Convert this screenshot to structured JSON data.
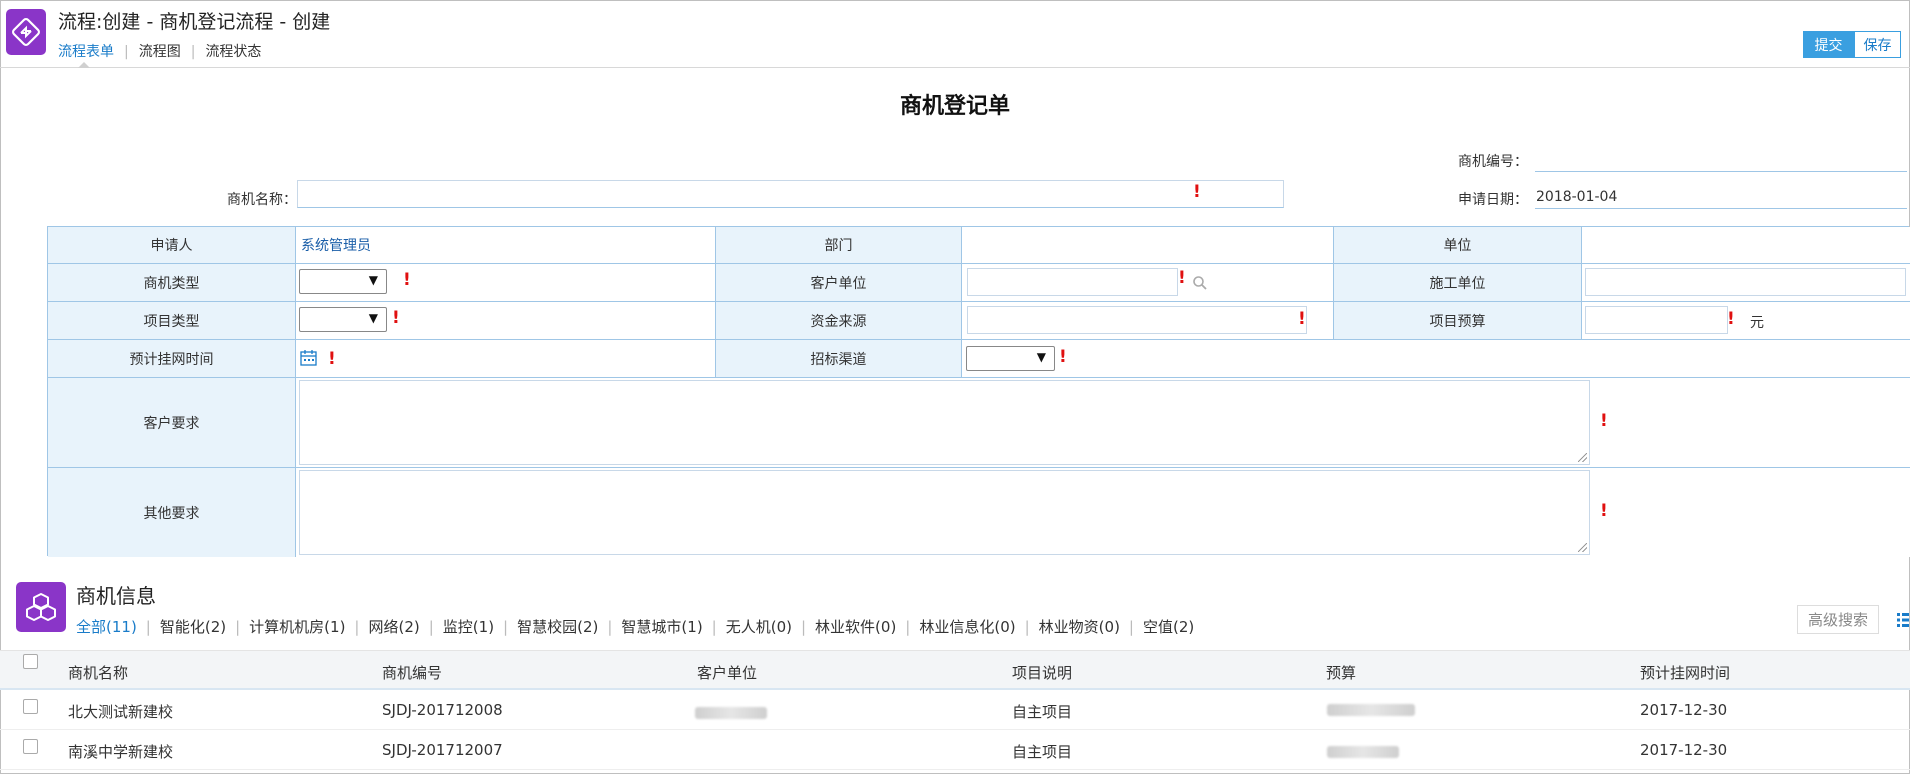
{
  "header": {
    "title": "流程:创建 - 商机登记流程 - 创建",
    "tabs": [
      {
        "label": "流程表单",
        "active": true
      },
      {
        "label": "流程图",
        "active": false
      },
      {
        "label": "流程状态",
        "active": false
      }
    ],
    "submit_label": "提交",
    "save_label": "保存"
  },
  "form": {
    "title": "商机登记单",
    "number_label": "商机编号：",
    "number_value": "",
    "name_label": "商机名称：",
    "name_value": "",
    "date_label": "申请日期：",
    "date_value": "2018-01-04",
    "grid": {
      "applicant_label": "申请人",
      "applicant_value": "系统管理员",
      "dept_label": "部门",
      "dept_value": "",
      "unit_label": "单位",
      "unit_value": "",
      "opp_type_label": "商机类型",
      "customer_unit_label": "客户单位",
      "construction_unit_label": "施工单位",
      "project_type_label": "项目类型",
      "fund_source_label": "资金来源",
      "project_budget_label": "项目预算",
      "budget_unit": "元",
      "online_time_label": "预计挂网时间",
      "bid_channel_label": "招标渠道",
      "customer_req_label": "客户要求",
      "other_req_label": "其他要求"
    },
    "required_mark": "!"
  },
  "opportunities": {
    "title": "商机信息",
    "filters": [
      {
        "label": "全部(11)",
        "active": true
      },
      {
        "label": "智能化(2)"
      },
      {
        "label": "计算机机房(1)"
      },
      {
        "label": "网络(2)"
      },
      {
        "label": "监控(1)"
      },
      {
        "label": "智慧校园(2)"
      },
      {
        "label": "智慧城市(1)"
      },
      {
        "label": "无人机(0)"
      },
      {
        "label": "林业软件(0)"
      },
      {
        "label": "林业信息化(0)"
      },
      {
        "label": "林业物资(0)"
      },
      {
        "label": "空值(2)"
      }
    ],
    "advanced_search_label": "高级搜索",
    "columns": [
      "商机名称",
      "商机编号",
      "客户单位",
      "项目说明",
      "预算",
      "预计挂网时间"
    ],
    "rows": [
      {
        "name": "北大测试新建校",
        "number": "SJDJ-201712008",
        "customer": "",
        "desc": "自主项目",
        "budget": "",
        "time": "2017-12-30"
      },
      {
        "name": "南溪中学新建校",
        "number": "SJDJ-201712007",
        "customer": "",
        "desc": "自主项目",
        "budget": "",
        "time": "2017-12-30"
      }
    ]
  },
  "icons": {
    "app": "flow-icon",
    "section": "cubes-icon",
    "calendar": "calendar-icon",
    "search": "search-icon",
    "list": "list-view-icon"
  },
  "colors": {
    "accent": "#1a7cc9",
    "brand_purple": "#8a35c8",
    "required": "#e01010",
    "header_cell_bg": "#e8f3fb",
    "button_blue": "#3a9fe0"
  }
}
